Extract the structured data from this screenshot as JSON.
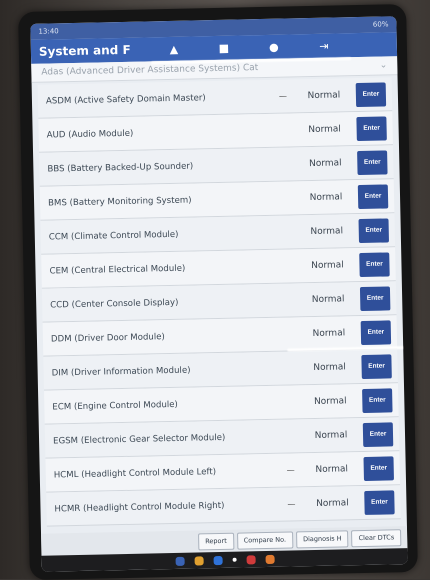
{
  "status_bar": {
    "time": "13:40",
    "battery": "60%"
  },
  "title_bar": {
    "title": "System and F",
    "icons": [
      "home-icon",
      "print-icon",
      "help-icon",
      "exit-icon"
    ]
  },
  "filter": {
    "value": "Adas (Advanced Driver Assistance Systems) Cat",
    "chevron": "chevron-down-icon"
  },
  "enter_label": "Enter",
  "modules": [
    {
      "name": "ASDM (Active Safety Domain Master)",
      "dash": true,
      "status": "Normal"
    },
    {
      "name": "AUD (Audio Module)",
      "dash": false,
      "status": "Normal"
    },
    {
      "name": "BBS (Battery Backed-Up Sounder)",
      "dash": false,
      "status": "Normal"
    },
    {
      "name": "BMS (Battery Monitoring System)",
      "dash": false,
      "status": "Normal"
    },
    {
      "name": "CCM (Climate Control Module)",
      "dash": false,
      "status": "Normal"
    },
    {
      "name": "CEM (Central Electrical Module)",
      "dash": false,
      "status": "Normal"
    },
    {
      "name": "CCD (Center Console Display)",
      "dash": false,
      "status": "Normal"
    },
    {
      "name": "DDM (Driver Door Module)",
      "dash": false,
      "status": "Normal"
    },
    {
      "name": "DIM (Driver Information Module)",
      "dash": false,
      "status": "Normal"
    },
    {
      "name": "ECM (Engine Control Module)",
      "dash": false,
      "status": "Normal"
    },
    {
      "name": "EGSM (Electronic Gear Selector Module)",
      "dash": false,
      "status": "Normal"
    },
    {
      "name": "HCML (Headlight Control Module Left)",
      "dash": true,
      "status": "Normal"
    },
    {
      "name": "HCMR (Headlight Control Module Right)",
      "dash": true,
      "status": "Normal"
    }
  ],
  "bottom_buttons": [
    "Report",
    "Compare No.",
    "Diagnosis H",
    "Clear DTCs"
  ],
  "colors": {
    "accent": "#3a63b5",
    "enter_button": "#2f4f9a",
    "background": "#e9edf2"
  }
}
